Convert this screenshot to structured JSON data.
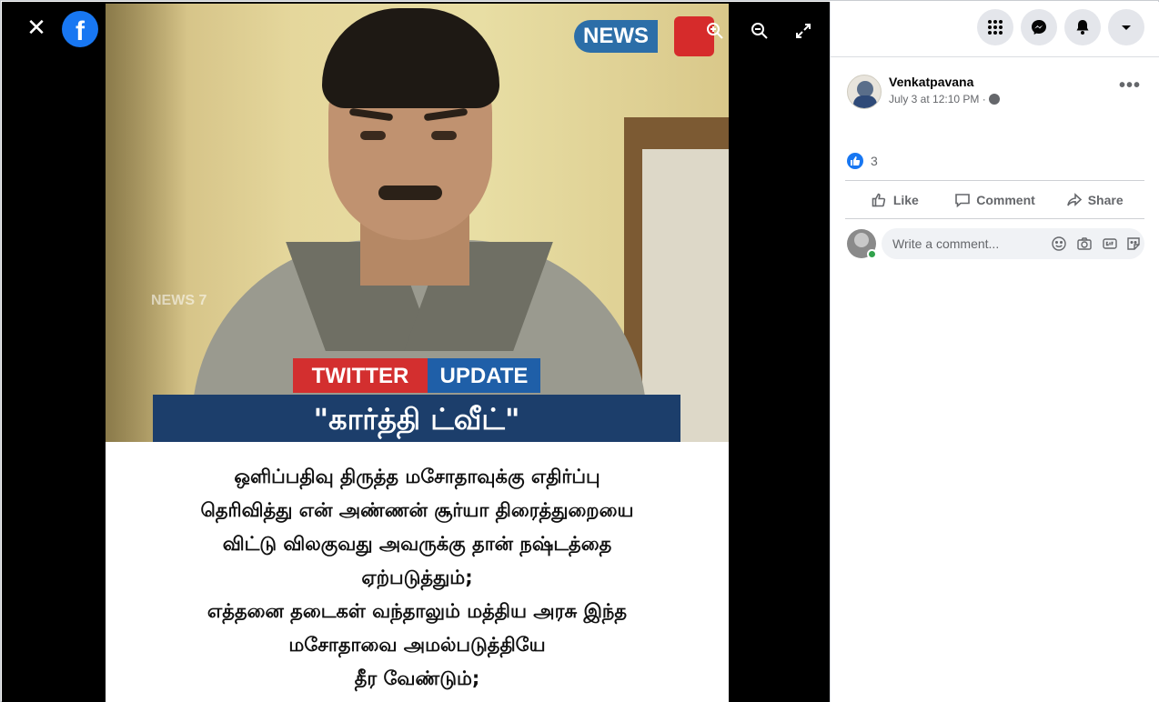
{
  "viewer": {
    "close_glyph": "✕",
    "fb_glyph": "f"
  },
  "photo": {
    "news_logo": "NEWS",
    "watermark": "NEWS 7",
    "banner_left": "TWITTER",
    "banner_right": "UPDATE",
    "banner_title": "\"கார்த்தி ட்வீட்\"",
    "body_lines": [
      "ஒளிப்பதிவு திருத்த மசோதாவுக்கு எதிர்ப்பு",
      "தெரிவித்து என் அண்ணன் சூர்யா திரைத்துறையை",
      "விட்டு விலகுவது அவருக்கு தான் நஷ்டத்தை",
      "ஏற்படுத்தும்;",
      "எத்தனை தடைகள் வந்தாலும் மத்திய அரசு இந்த",
      "மசோதாவை அமல்படுத்தியே",
      "தீர வேண்டும்;"
    ]
  },
  "post": {
    "author": "Venkatpavana",
    "timestamp": "July 3 at 12:10 PM ·",
    "more_glyph": "•••",
    "reaction_count": "3"
  },
  "actions": {
    "like": "Like",
    "comment": "Comment",
    "share": "Share"
  },
  "comment_box": {
    "placeholder": "Write a comment..."
  },
  "colors": {
    "accent": "#1877f2",
    "online": "#31a24c"
  }
}
